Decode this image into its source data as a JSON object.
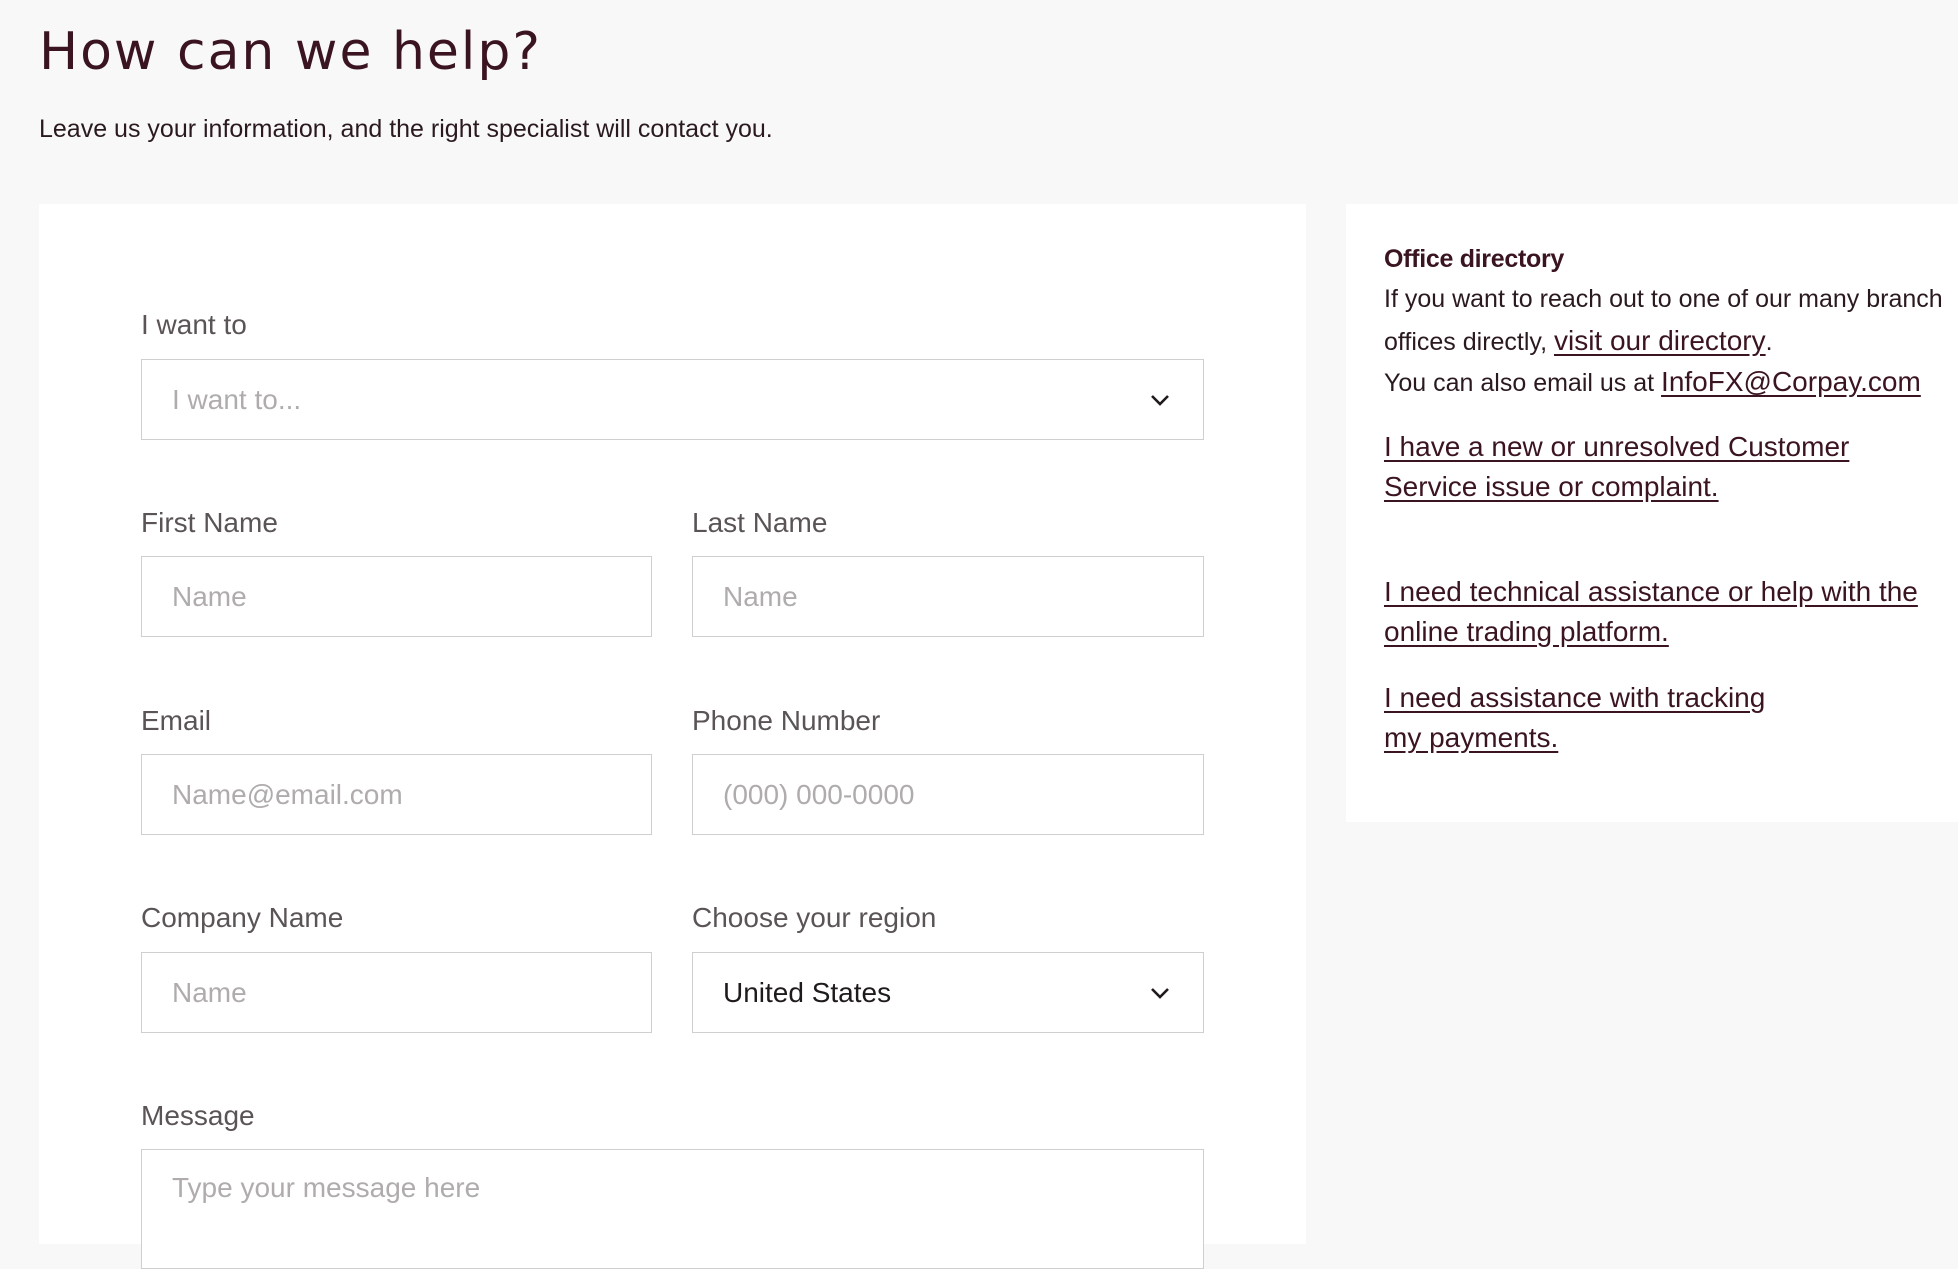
{
  "header": {
    "title": "How can we help?",
    "subtitle": "Leave us your information, and the right specialist will contact you."
  },
  "form": {
    "intent": {
      "label": "I want to",
      "placeholder": "I want to..."
    },
    "first_name": {
      "label": "First Name",
      "placeholder": "Name"
    },
    "last_name": {
      "label": "Last Name",
      "placeholder": "Name"
    },
    "email": {
      "label": "Email",
      "placeholder": "Name@email.com"
    },
    "phone": {
      "label": "Phone Number",
      "placeholder": "(000) 000-0000"
    },
    "company": {
      "label": "Company Name",
      "placeholder": "Name"
    },
    "region": {
      "label": "Choose your region",
      "value": "United States"
    },
    "message": {
      "label": "Message",
      "placeholder": "Type your message here"
    }
  },
  "sidebar": {
    "title": "Office directory",
    "intro_text": "If you want to reach out to one of our many branch offices directly,",
    "directory_link": "visit our directory",
    "period": ".",
    "email_text": "You can also email us at",
    "email_link": "InfoFX@Corpay.com",
    "links": [
      {
        "label": "I have a new or unresolved Customer Service issue or complaint."
      },
      {
        "label": "I need technical assistance or help with the online trading platform."
      },
      {
        "label": "I need assistance with tracking my payments."
      }
    ]
  },
  "colors": {
    "brand": "#3a1421",
    "background": "#f8f8f8",
    "card": "#ffffff",
    "border": "#cfcfcf"
  },
  "icons": {
    "dropdown": "chevron-down-icon"
  }
}
